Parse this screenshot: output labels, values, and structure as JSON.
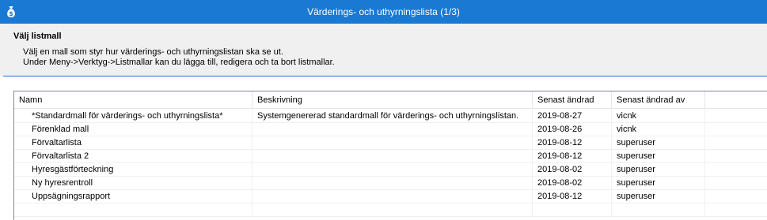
{
  "window": {
    "title": "Värderings- och uthyrningslista (1/3)",
    "icon": "money-bag-icon"
  },
  "header": {
    "title": "Välj listmall",
    "line1": "Välj en mall som styr hur värderings- och uthyrningslistan ska se ut.",
    "line2": "Under Meny->Verktyg->Listmallar kan du lägga till, redigera och ta bort listmallar."
  },
  "list": {
    "columns": [
      "Namn",
      "Beskrivning",
      "Senast ändrad",
      "Senast ändrad av"
    ],
    "rows": [
      {
        "name": "*Standardmall för värderings- och uthyrningslista*",
        "description": "Systemgenererad standardmall för värderings- och uthyrningslistan.",
        "modified": "2019-08-27",
        "modified_by": "vicnk"
      },
      {
        "name": "Förenklad mall",
        "description": "",
        "modified": "2019-08-26",
        "modified_by": "vicnk"
      },
      {
        "name": "Förvaltarlista",
        "description": "",
        "modified": "2019-08-12",
        "modified_by": "superuser"
      },
      {
        "name": "Förvaltarlista 2",
        "description": "",
        "modified": "2019-08-12",
        "modified_by": "superuser"
      },
      {
        "name": "Hyresgästförteckning",
        "description": "",
        "modified": "2019-08-02",
        "modified_by": "superuser"
      },
      {
        "name": "Ny hyresrentroll",
        "description": "",
        "modified": "2019-08-02",
        "modified_by": "superuser"
      },
      {
        "name": "Uppsägningsrapport",
        "description": "",
        "modified": "2019-08-12",
        "modified_by": "superuser"
      }
    ]
  },
  "colors": {
    "titlebar": "#1979d3",
    "header_bg": "#f0f0f0",
    "separator": "#1979d3"
  }
}
